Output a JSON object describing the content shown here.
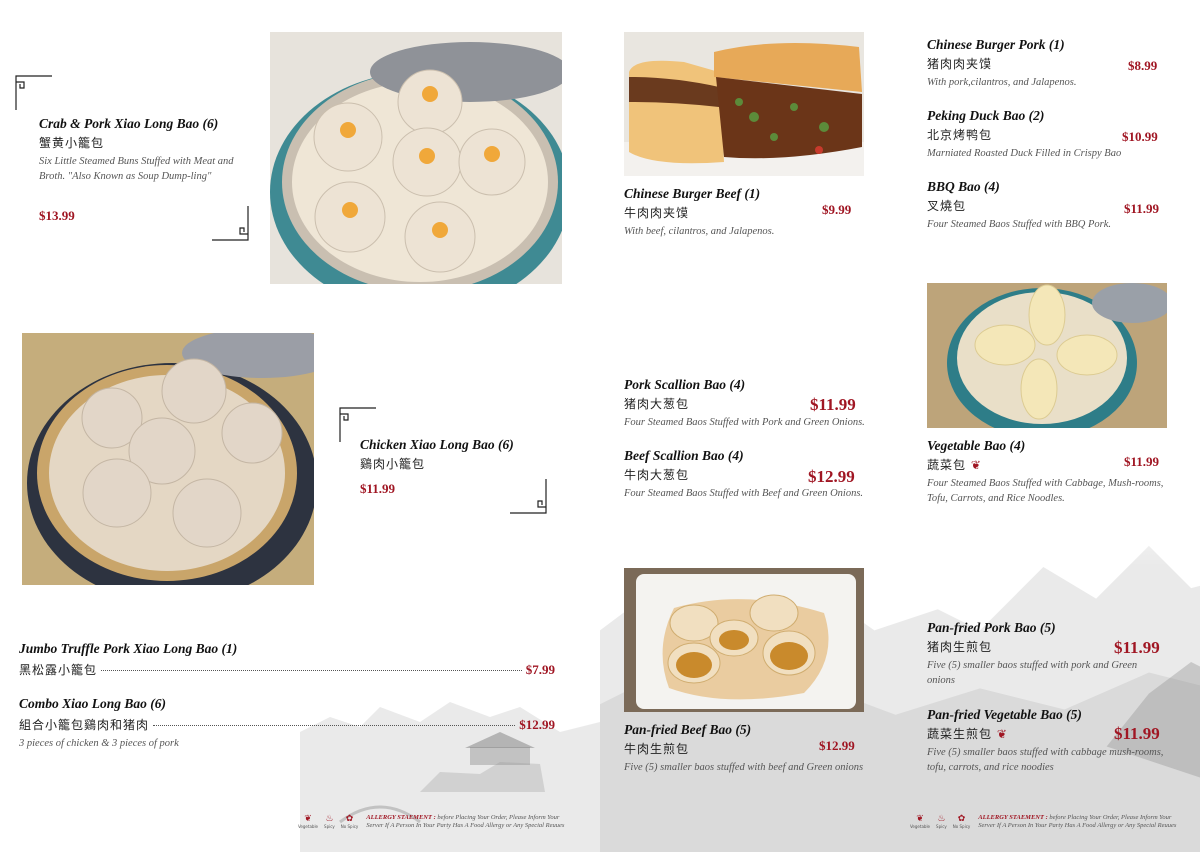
{
  "colors": {
    "price": "#a01623",
    "title": "#111111",
    "description": "#555555"
  },
  "left_page": {
    "items": [
      {
        "title": "Crab & Pork Xiao Long Bao (6)",
        "chinese": "蟹黄小籠包",
        "description": "Six Little Steamed Buns Stuffed with Meat and Broth. \"Also Known as Soup Dump-ling\"",
        "price": "$13.99"
      },
      {
        "title": "Chicken Xiao Long Bao (6)",
        "chinese": "鷄肉小籠包",
        "price": "$11.99"
      },
      {
        "title": "Jumbo Truffle Pork Xiao Long Bao (1)",
        "chinese": "黑松露小籠包",
        "price": "$7.99"
      },
      {
        "title": "Combo Xiao Long Bao (6)",
        "chinese": "組合小籠包鷄肉和猪肉",
        "description": "3 pieces of chicken & 3 pieces of pork",
        "price": "$12.99"
      }
    ],
    "legend": {
      "icons": [
        {
          "glyph": "❦",
          "label": "Vegetable"
        },
        {
          "glyph": "♨",
          "label": "Spicy"
        },
        {
          "glyph": "✿",
          "label": "No Spicy"
        }
      ],
      "allergy_heading": "ALLERGY STAEMENT :",
      "allergy_text": "before Placing Your Order, Please Inform Your Server If A Person In Your Party Has A Food Allergy or Any Special Reuues"
    }
  },
  "right_page": {
    "items": [
      {
        "title": "Chinese Burger Beef (1)",
        "chinese": "牛肉肉夹馍",
        "description": "With beef, cilantros, and Jalapenos.",
        "price": "$9.99"
      },
      {
        "title": "Chinese Burger Pork (1)",
        "chinese": "猪肉肉夹馍",
        "description": "With pork,cilantros, and Jalapenos.",
        "price": "$8.99"
      },
      {
        "title": "Peking Duck Bao (2)",
        "chinese": "北京烤鸭包",
        "description": "Marniated Roasted Duck Filled in Crispy Bao",
        "price": "$10.99"
      },
      {
        "title": "BBQ Bao (4)",
        "chinese": "叉燒包",
        "description": "Four Steamed Baos Stuffed with BBQ Pork.",
        "price": "$11.99"
      },
      {
        "title": "Pork Scallion Bao (4)",
        "chinese": "猪肉大葱包",
        "description": "Four Steamed Baos Stuffed with Pork and Green Onions.",
        "price": "$11.99"
      },
      {
        "title": "Beef Scallion Bao (4)",
        "chinese": "牛肉大葱包",
        "description": "Four Steamed Baos Stuffed with Beef and Green Onions.",
        "price": "$12.99"
      },
      {
        "title": "Vegetable Bao (4)",
        "chinese": "蔬菜包",
        "description": "Four Steamed Baos Stuffed with Cabbage, Mush-rooms, Tofu, Carrots, and Rice Noodles.",
        "price": "$11.99"
      },
      {
        "title": "Pan-fried Pork Bao (5)",
        "chinese": "猪肉生煎包",
        "description": "Five (5) smaller baos stuffed with pork and Green onions",
        "price": "$11.99"
      },
      {
        "title": "Pan-fried Beef Bao (5)",
        "chinese": "牛肉生煎包",
        "description": "Five (5) smaller baos stuffed with beef and Green onions",
        "price": "$12.99"
      },
      {
        "title": "Pan-fried Vegetable Bao (5)",
        "chinese": "蔬菜生煎包",
        "description": "Five (5) smaller baos stuffed with cabbage mush-rooms, tofu, carrots, and rice noodies",
        "price": "$11.99"
      }
    ],
    "legend": {
      "icons": [
        {
          "glyph": "❦",
          "label": "Vegetable"
        },
        {
          "glyph": "♨",
          "label": "Spicy"
        },
        {
          "glyph": "✿",
          "label": "No Spicy"
        }
      ],
      "allergy_heading": "ALLERGY STAEMENT :",
      "allergy_text": "before Placing Your Order, Please Inform Your Server If A Person In Your Party Has A Food Allergy or Any Special Reuues"
    }
  }
}
